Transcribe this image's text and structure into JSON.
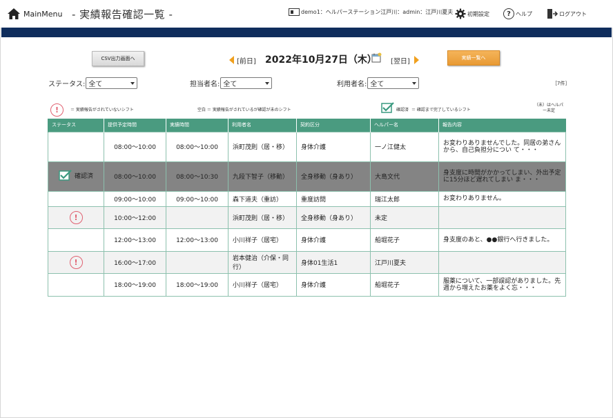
{
  "header": {
    "main_menu": "MainMenu",
    "page_title": "- 実績報告確認一覧 -",
    "user_info": "demo1：ヘルパーステーション江戸川：admin：江戸川夏夫",
    "settings": "初期設定",
    "help": "ヘルプ",
    "logout": "ログアウト"
  },
  "toolbar": {
    "csv_button": "CSV出力画面へ",
    "prev_day": "[前日]",
    "date": "2022年10月27日（木）",
    "next_day": "[翌日]",
    "list_button": "実績一覧へ"
  },
  "filters": {
    "status_label": "ステータス:",
    "status_value": "全て",
    "staff_label": "担当者名:",
    "staff_value": "全て",
    "user_label": "利用者名:",
    "user_value": "全て",
    "count": "［7件］"
  },
  "legend": {
    "unreported": "＝ 実績報告がされていないシフト",
    "blank": "空白 ＝ 実績報告がされているが確認が未のシフト",
    "confirmed_label": "確認済",
    "confirmed_text": "＝ 確認まで完了しているシフト",
    "note_line1": "（未）はヘルパ",
    "note_line2": "ー未定"
  },
  "table": {
    "headers": [
      "ステータス",
      "提供予定時間",
      "実績時間",
      "利用者名",
      "契約区分",
      "ヘルパー名",
      "報告内容"
    ],
    "rows": [
      {
        "status": "",
        "planned": "08:00〜10:00",
        "actual": "08:00〜10:00",
        "user": "浜町茂則（居・移）",
        "category": "身体介護",
        "helper": "一ノ江健太",
        "report": "お変わりありませんでした。同居の弟さんから、自己負担分につい て・・・"
      },
      {
        "status": "確認済",
        "planned": "08:00〜10:00",
        "actual": "08:00〜10:30",
        "user": "九段下智子（移動）",
        "category": "全身移動（身あり）",
        "helper": "大島文代",
        "report": "身支度に時間がかかってしまい、外出予定に15分ほど遅れてしまい ま・・・"
      },
      {
        "status": "",
        "planned": "09:00〜10:00",
        "actual": "09:00〜10:00",
        "user": "森下道夫（重訪）",
        "category": "重度訪問",
        "helper": "瑞江太郎",
        "report": "お変わりありません。"
      },
      {
        "status": "!",
        "planned": "10:00〜12:00",
        "actual": "",
        "user": "浜町茂則（居・移）",
        "category": "全身移動（身あり）",
        "helper": "未定",
        "report": ""
      },
      {
        "status": "",
        "planned": "12:00〜13:00",
        "actual": "12:00〜13:00",
        "user": "小川祥子（居宅）",
        "category": "身体介護",
        "helper": "船堀花子",
        "report": "身支度のあと、●●銀行へ行きました。"
      },
      {
        "status": "!",
        "planned": "16:00〜17:00",
        "actual": "",
        "user": "岩本健治（介保・同行）",
        "category": "身体01生活1",
        "helper": "江戸川夏夫",
        "report": ""
      },
      {
        "status": "",
        "planned": "18:00〜19:00",
        "actual": "18:00〜19:00",
        "user": "小川祥子（居宅）",
        "category": "身体介護",
        "helper": "船堀花子",
        "report": "服薬について、一部誤認がありました。先週から増えたお薬をよく忘・・・"
      }
    ]
  },
  "colors": {
    "navbar": "#0f2d5c",
    "table_header": "#4a9b80",
    "confirmed_row": "#848484",
    "alert": "#e06070",
    "orange_button": "#e89a33"
  }
}
